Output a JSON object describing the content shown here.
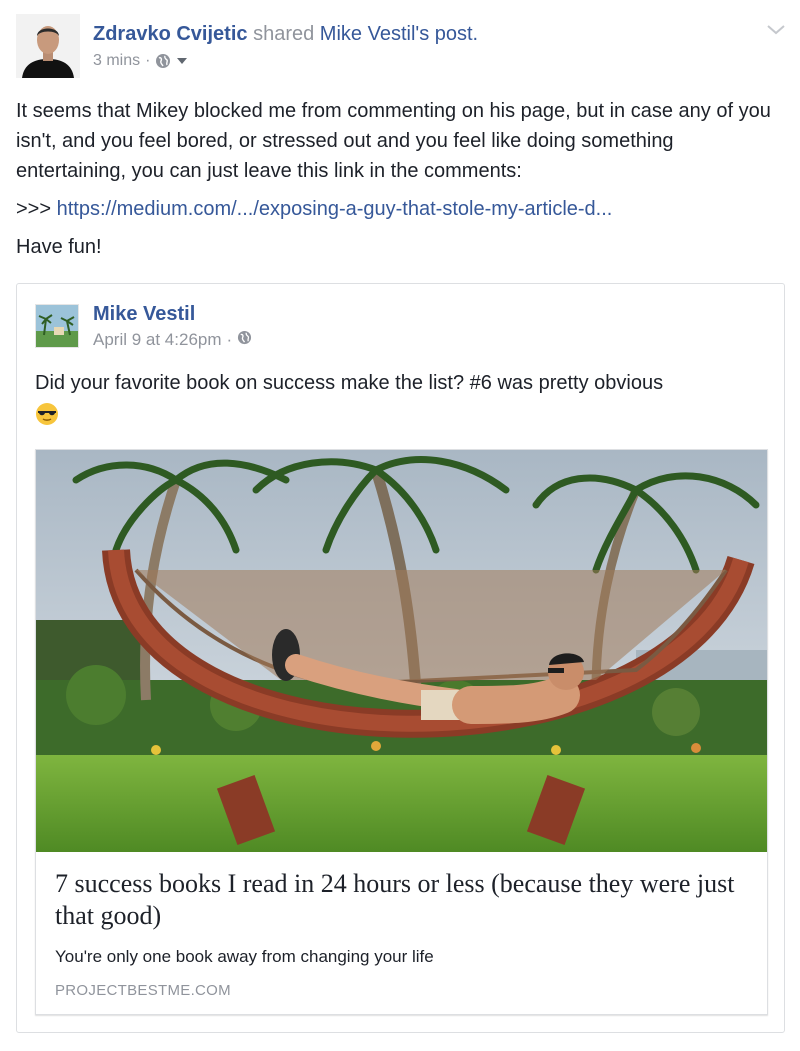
{
  "header": {
    "author": "Zdravko Cvijetic",
    "shared_text": "shared",
    "post_owner_link": "Mike Vestil's post.",
    "timestamp": "3 mins",
    "separator": "·"
  },
  "body": {
    "paragraph1": "It seems that Mikey blocked me from commenting on his page, but in case any of you isn't, and you feel bored, or stressed out and you feel like doing something entertaining, you can just leave this link in the comments:",
    "link_prefix": ">>> ",
    "link_text": "https://medium.com/.../exposing-a-guy-that-stole-my-article-d...",
    "paragraph3": "Have fun!"
  },
  "shared_post": {
    "author": "Mike Vestil",
    "timestamp": "April 9 at 4:26pm",
    "separator": "·",
    "text": "Did your favorite book on success make the list? #6 was pretty obvious"
  },
  "link_preview": {
    "title": "7 success books I read in 24 hours or less (because they were just that good)",
    "description": "You're only one book away from changing your life",
    "domain": "PROJECTBESTME.COM"
  },
  "icons": {
    "privacy": "globe-icon",
    "audience_menu": "caret-down-icon",
    "post_menu": "chevron-down-icon",
    "emoji": "sunglasses-emoji"
  },
  "colors": {
    "link_blue": "#365899",
    "meta_gray": "#90949c",
    "text": "#1d2129",
    "border": "#dddfe2"
  }
}
